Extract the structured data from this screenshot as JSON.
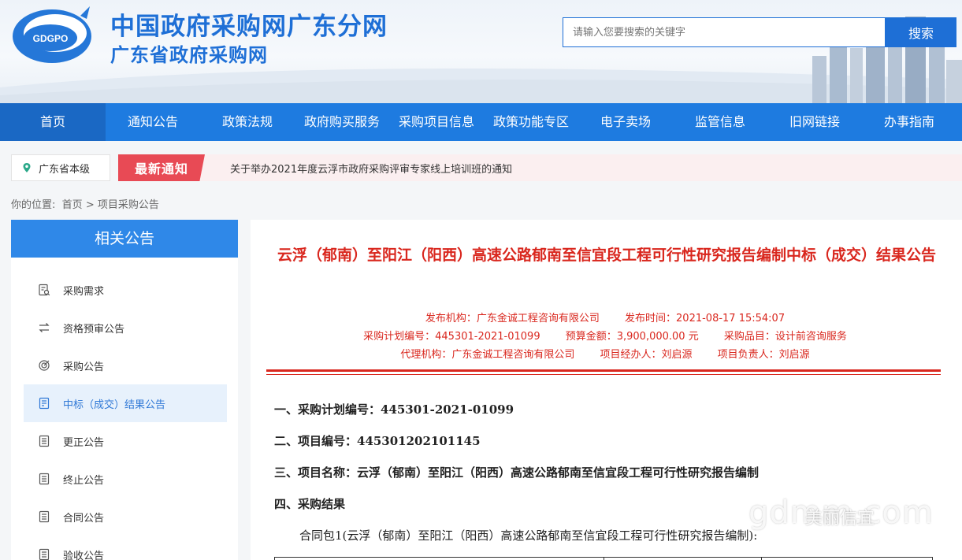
{
  "header": {
    "logo_text": "GDGPO",
    "title": "中国政府采购网广东分网",
    "subtitle": "广东省政府采购网",
    "search_placeholder": "请输入您要搜索的关键字",
    "search_button": "搜索"
  },
  "nav": {
    "items": [
      "首页",
      "通知公告",
      "政策法规",
      "政府购买服务",
      "采购项目信息",
      "政策功能专区",
      "电子卖场",
      "监管信息",
      "旧网链接",
      "办事指南"
    ]
  },
  "notice": {
    "location": "广东省本级",
    "tag": "最新通知",
    "text": "关于举办2021年度云浮市政府采购评审专家线上培训班的通知"
  },
  "breadcrumb": {
    "label": "你的位置:",
    "home": "首页",
    "sep": ">",
    "current": "项目采购公告"
  },
  "sidebar": {
    "title": "相关公告",
    "items": [
      {
        "label": "采购需求",
        "icon": "document-search-icon"
      },
      {
        "label": "资格预审公告",
        "icon": "swap-arrows-icon"
      },
      {
        "label": "采购公告",
        "icon": "target-icon"
      },
      {
        "label": "中标（成交）结果公告",
        "icon": "document-list-icon"
      },
      {
        "label": "更正公告",
        "icon": "document-icon"
      },
      {
        "label": "终止公告",
        "icon": "document-icon"
      },
      {
        "label": "合同公告",
        "icon": "document-icon"
      },
      {
        "label": "验收公告",
        "icon": "document-icon"
      }
    ],
    "active_index": 3
  },
  "article": {
    "title": "云浮（郁南）至阳江（阳西）高速公路郁南至信宜段工程可行性研究报告编制中标（成交）结果公告",
    "meta_row1": [
      "发布机构：广东金诚工程咨询有限公司",
      "发布时间：2021-08-17 15:54:07"
    ],
    "meta_row2": [
      "采购计划编号：445301-2021-01099",
      "预算金额：3,900,000.00 元",
      "采购品目：设计前咨询服务"
    ],
    "meta_row3": [
      "代理机构：广东金诚工程咨询有限公司",
      "项目经办人：刘启源",
      "项目负责人：刘启源"
    ],
    "sections": [
      "一、采购计划编号：445301-2021-01099",
      "二、项目编号：445301202101145",
      "三、项目名称：云浮（郁南）至阳江（阳西）高速公路郁南至信宜段工程可行性研究报告编制",
      "四、采购结果"
    ],
    "paragraph": "合同包1(云浮（郁南）至阳江（阳西）高速公路郁南至信宜段工程可行性研究报告编制):"
  },
  "watermark": {
    "text": "gdmm.com",
    "badge": "美丽信宜"
  },
  "colors": {
    "brand_blue": "#1e6fd6",
    "nav_blue": "#1e7be0",
    "accent_red": "#d9271e",
    "notice_red": "#e84a55"
  }
}
